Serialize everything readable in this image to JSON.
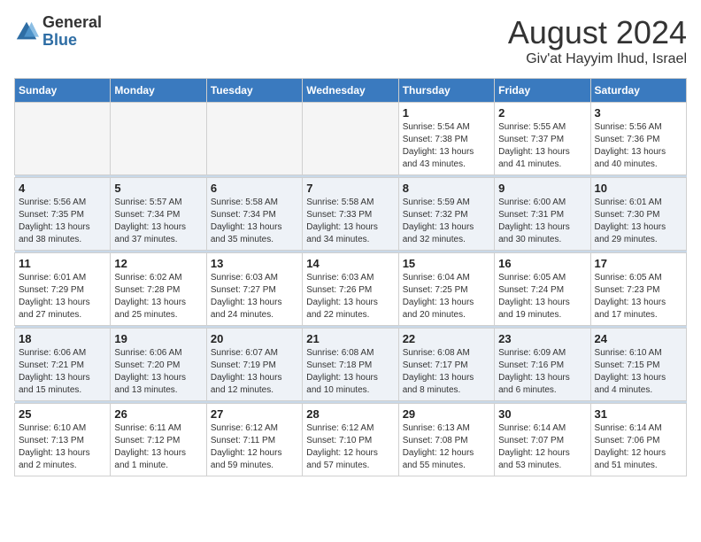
{
  "header": {
    "logo_general": "General",
    "logo_blue": "Blue",
    "month_year": "August 2024",
    "location": "Giv'at Hayyim Ihud, Israel"
  },
  "weekdays": [
    "Sunday",
    "Monday",
    "Tuesday",
    "Wednesday",
    "Thursday",
    "Friday",
    "Saturday"
  ],
  "weeks": [
    [
      {
        "day": "",
        "empty": true
      },
      {
        "day": "",
        "empty": true
      },
      {
        "day": "",
        "empty": true
      },
      {
        "day": "",
        "empty": true
      },
      {
        "day": "1",
        "sunrise": "5:54 AM",
        "sunset": "7:38 PM",
        "daylight": "13 hours and 43 minutes."
      },
      {
        "day": "2",
        "sunrise": "5:55 AM",
        "sunset": "7:37 PM",
        "daylight": "13 hours and 41 minutes."
      },
      {
        "day": "3",
        "sunrise": "5:56 AM",
        "sunset": "7:36 PM",
        "daylight": "13 hours and 40 minutes."
      }
    ],
    [
      {
        "day": "4",
        "sunrise": "5:56 AM",
        "sunset": "7:35 PM",
        "daylight": "13 hours and 38 minutes."
      },
      {
        "day": "5",
        "sunrise": "5:57 AM",
        "sunset": "7:34 PM",
        "daylight": "13 hours and 37 minutes."
      },
      {
        "day": "6",
        "sunrise": "5:58 AM",
        "sunset": "7:34 PM",
        "daylight": "13 hours and 35 minutes."
      },
      {
        "day": "7",
        "sunrise": "5:58 AM",
        "sunset": "7:33 PM",
        "daylight": "13 hours and 34 minutes."
      },
      {
        "day": "8",
        "sunrise": "5:59 AM",
        "sunset": "7:32 PM",
        "daylight": "13 hours and 32 minutes."
      },
      {
        "day": "9",
        "sunrise": "6:00 AM",
        "sunset": "7:31 PM",
        "daylight": "13 hours and 30 minutes."
      },
      {
        "day": "10",
        "sunrise": "6:01 AM",
        "sunset": "7:30 PM",
        "daylight": "13 hours and 29 minutes."
      }
    ],
    [
      {
        "day": "11",
        "sunrise": "6:01 AM",
        "sunset": "7:29 PM",
        "daylight": "13 hours and 27 minutes."
      },
      {
        "day": "12",
        "sunrise": "6:02 AM",
        "sunset": "7:28 PM",
        "daylight": "13 hours and 25 minutes."
      },
      {
        "day": "13",
        "sunrise": "6:03 AM",
        "sunset": "7:27 PM",
        "daylight": "13 hours and 24 minutes."
      },
      {
        "day": "14",
        "sunrise": "6:03 AM",
        "sunset": "7:26 PM",
        "daylight": "13 hours and 22 minutes."
      },
      {
        "day": "15",
        "sunrise": "6:04 AM",
        "sunset": "7:25 PM",
        "daylight": "13 hours and 20 minutes."
      },
      {
        "day": "16",
        "sunrise": "6:05 AM",
        "sunset": "7:24 PM",
        "daylight": "13 hours and 19 minutes."
      },
      {
        "day": "17",
        "sunrise": "6:05 AM",
        "sunset": "7:23 PM",
        "daylight": "13 hours and 17 minutes."
      }
    ],
    [
      {
        "day": "18",
        "sunrise": "6:06 AM",
        "sunset": "7:21 PM",
        "daylight": "13 hours and 15 minutes."
      },
      {
        "day": "19",
        "sunrise": "6:06 AM",
        "sunset": "7:20 PM",
        "daylight": "13 hours and 13 minutes."
      },
      {
        "day": "20",
        "sunrise": "6:07 AM",
        "sunset": "7:19 PM",
        "daylight": "13 hours and 12 minutes."
      },
      {
        "day": "21",
        "sunrise": "6:08 AM",
        "sunset": "7:18 PM",
        "daylight": "13 hours and 10 minutes."
      },
      {
        "day": "22",
        "sunrise": "6:08 AM",
        "sunset": "7:17 PM",
        "daylight": "13 hours and 8 minutes."
      },
      {
        "day": "23",
        "sunrise": "6:09 AM",
        "sunset": "7:16 PM",
        "daylight": "13 hours and 6 minutes."
      },
      {
        "day": "24",
        "sunrise": "6:10 AM",
        "sunset": "7:15 PM",
        "daylight": "13 hours and 4 minutes."
      }
    ],
    [
      {
        "day": "25",
        "sunrise": "6:10 AM",
        "sunset": "7:13 PM",
        "daylight": "13 hours and 2 minutes."
      },
      {
        "day": "26",
        "sunrise": "6:11 AM",
        "sunset": "7:12 PM",
        "daylight": "13 hours and 1 minute."
      },
      {
        "day": "27",
        "sunrise": "6:12 AM",
        "sunset": "7:11 PM",
        "daylight": "12 hours and 59 minutes."
      },
      {
        "day": "28",
        "sunrise": "6:12 AM",
        "sunset": "7:10 PM",
        "daylight": "12 hours and 57 minutes."
      },
      {
        "day": "29",
        "sunrise": "6:13 AM",
        "sunset": "7:08 PM",
        "daylight": "12 hours and 55 minutes."
      },
      {
        "day": "30",
        "sunrise": "6:14 AM",
        "sunset": "7:07 PM",
        "daylight": "12 hours and 53 minutes."
      },
      {
        "day": "31",
        "sunrise": "6:14 AM",
        "sunset": "7:06 PM",
        "daylight": "12 hours and 51 minutes."
      }
    ]
  ]
}
